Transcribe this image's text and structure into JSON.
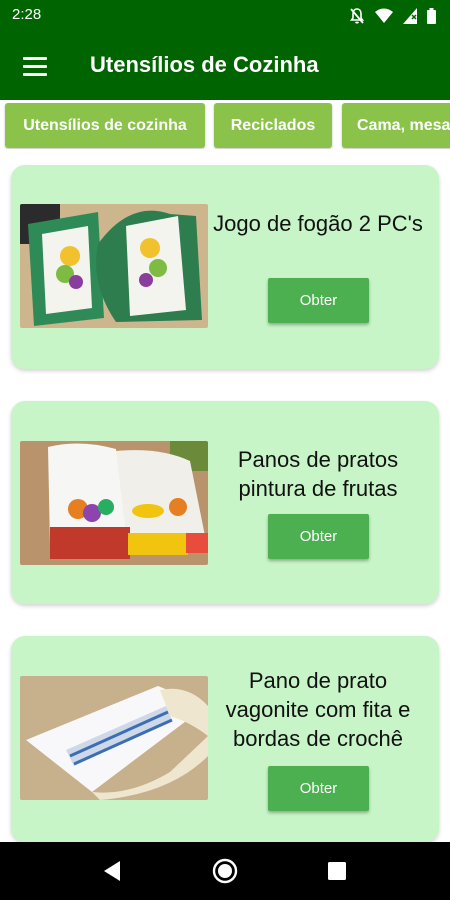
{
  "status_bar": {
    "time": "2:28"
  },
  "app_bar": {
    "title": "Utensílios de Cozinha"
  },
  "categories": [
    {
      "label": "Utensílios de cozinha"
    },
    {
      "label": "Reciclados"
    },
    {
      "label": "Cama, mesa"
    }
  ],
  "products": [
    {
      "title": "Jogo de fogão 2 PC's",
      "button": "Obter"
    },
    {
      "title": "Panos de pratos pintura de frutas",
      "button": "Obter"
    },
    {
      "title": "Pano de prato vagonite com fita e bordas de crochê",
      "button": "Obter"
    }
  ],
  "colors": {
    "app_bar": "#006400",
    "chip": "#8bc34a",
    "card": "#c8f5c8",
    "button": "#4caf50"
  },
  "icons": {
    "menu": "hamburger-menu-icon",
    "status": [
      "notifications-off-icon",
      "wifi-icon",
      "cell-signal-icon",
      "battery-icon"
    ],
    "nav": [
      "back-icon",
      "home-icon",
      "recents-icon"
    ]
  }
}
